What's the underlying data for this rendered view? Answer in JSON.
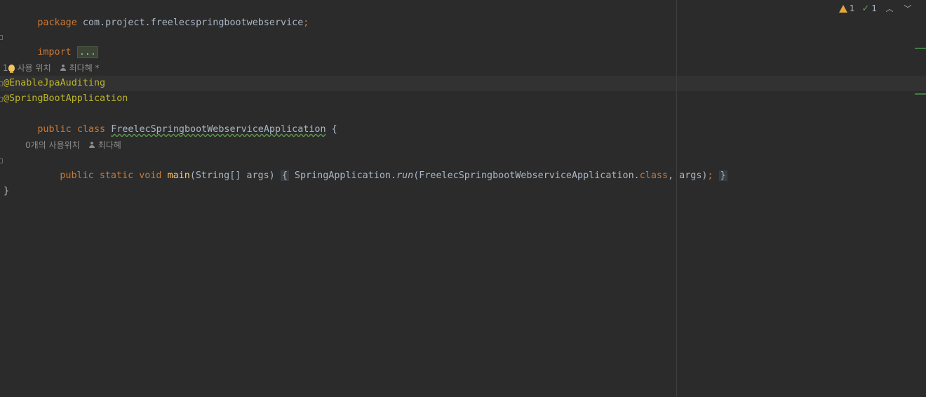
{
  "editor": {
    "lines": {
      "package": {
        "kw": "package",
        "name": " com.project.freelecspringbootwebservice",
        "semi": ";"
      },
      "import": {
        "kw": "import",
        "folded": "..."
      },
      "annotation1": "@EnableJpaAuditing",
      "annotation2": "@SpringBootApplication",
      "class_decl": {
        "mod1": "public",
        "mod2": "class",
        "name": "FreelecSpringbootWebserviceApplication",
        "brace": " {"
      },
      "main": {
        "mod1": "public",
        "mod2": "static",
        "mod3": "void",
        "name": "main",
        "params": "(String[] args) ",
        "open_brace": "{",
        "call_obj": " SpringApplication.",
        "call_fn": "run",
        "call_args1": "(FreelecSpringbootWebserviceApplication.",
        "call_kw": "class",
        "call_args2": ", args)",
        "semi": ";",
        "close_brace": "}"
      },
      "closing": "}"
    },
    "hints": {
      "class_usages_count": "1",
      "class_usages_label": "사용 위치",
      "class_author": "최다혜 *",
      "method_usages": "0개의 사용위치",
      "method_author": "최다혜"
    }
  },
  "status": {
    "warnings": "1",
    "checks": "1",
    "up_icon": "chevron-up-icon",
    "down_icon": "chevron-down-icon",
    "warning_color": "#e0a83e",
    "check_color": "#5fa05f"
  }
}
